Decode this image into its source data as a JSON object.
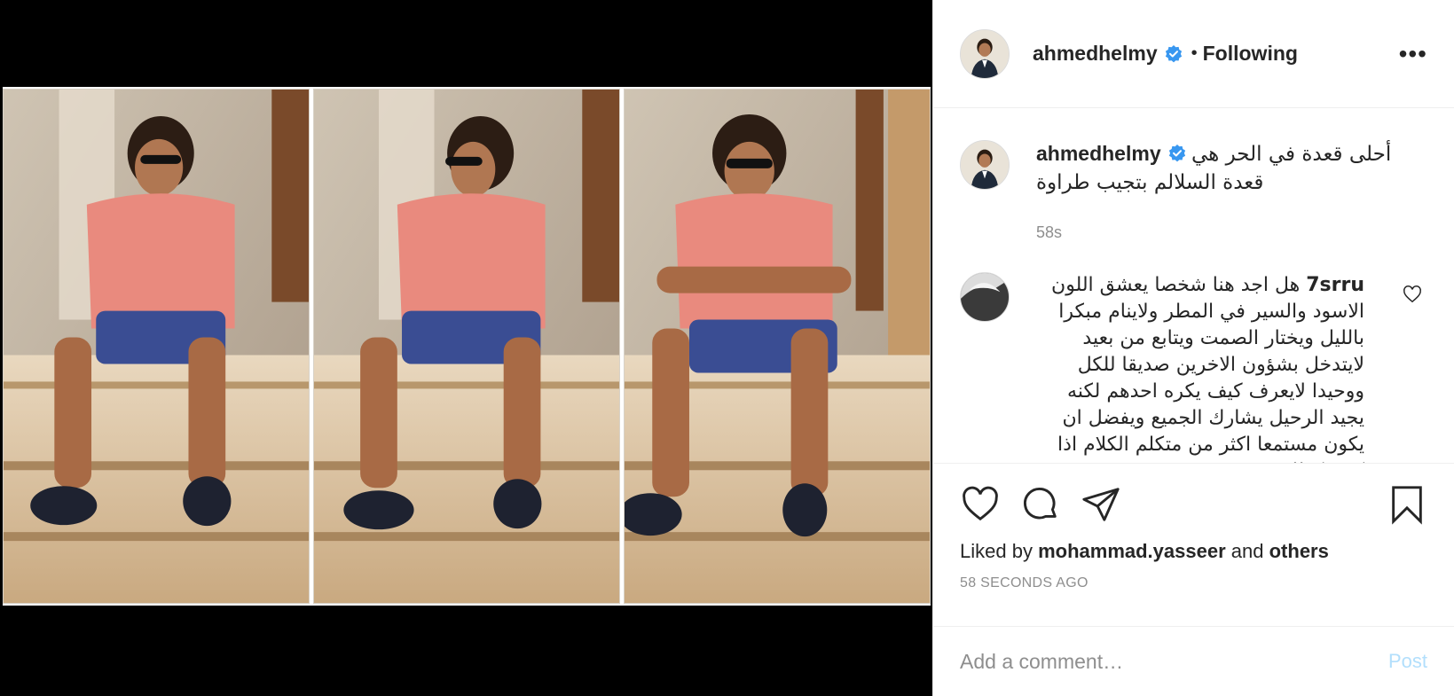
{
  "post": {
    "username": "ahmedhelmy",
    "dot": "•",
    "follow_state": "Following",
    "more_label": "•••"
  },
  "caption": {
    "username": "ahmedhelmy",
    "text": "أحلى قعدة في الحر هي قعدة السلالم بتجيب طراوة",
    "time": "58s"
  },
  "comment": {
    "username": "7srru",
    "text": "هل اجد هنا شخصا يعشق اللون الاسود والسير في المطر ولاينام مبكرا بالليل ويختار الصمت ويتابع من بعيد لايتدخل بشؤون الاخرين صديقا للكل ووحيدا لايعرف كيف يكره احدهم لكنه يجيد الرحيل يشارك الجميع ويفضل ان يكون مستمعا اكثر من متكلم الكلام اذا كنت كذلك"
  },
  "likes": {
    "prefix": "Liked by",
    "user": "mohammad.yasseer",
    "and": "and",
    "others": "others"
  },
  "timestamp": "58 SECONDS AGO",
  "add_comment": {
    "placeholder": "Add a comment…",
    "post_label": "Post"
  },
  "colors": {
    "verified": "#3897f0",
    "post_disabled": "#b2dffc",
    "muted": "#8e8e8e"
  },
  "icons": [
    "heart-icon",
    "comment-icon",
    "share-icon",
    "bookmark-icon",
    "verified-icon",
    "more-icon"
  ]
}
